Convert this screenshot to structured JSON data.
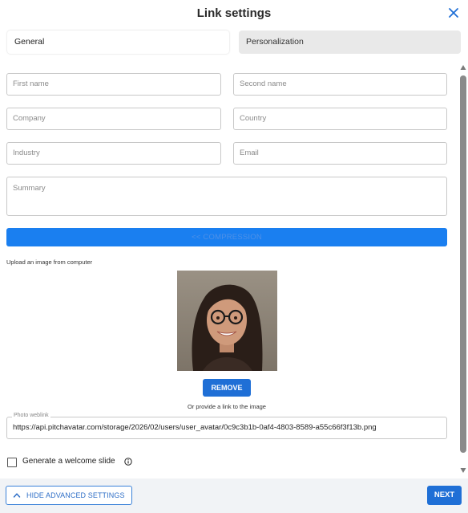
{
  "dialog": {
    "title": "Link settings"
  },
  "tabs": [
    {
      "label": "General"
    },
    {
      "label": "Personalization"
    }
  ],
  "fields": {
    "first_name": {
      "placeholder": "First name",
      "value": ""
    },
    "second_name": {
      "placeholder": "Second name",
      "value": ""
    },
    "company": {
      "placeholder": "Company",
      "value": ""
    },
    "country": {
      "placeholder": "Country",
      "value": ""
    },
    "industry": {
      "placeholder": "Industry",
      "value": ""
    },
    "email": {
      "placeholder": "Email",
      "value": ""
    },
    "summary": {
      "placeholder": "Summary",
      "value": ""
    }
  },
  "compression": {
    "label": "<< COMPRESSION"
  },
  "upload": {
    "label": "Upload an image from computer",
    "remove_label": "REMOVE",
    "link_note": "Or provide a link to the image"
  },
  "photo_weblink": {
    "label": "Photo weblink",
    "value": "https://api.pitchavatar.com/storage/2026/02/users/user_avatar/0c9c3b1b-0af4-4803-8589-a55c66f3f13b.png"
  },
  "welcome": {
    "label": "Generate a welcome slide",
    "checked": false
  },
  "footer": {
    "hide_label": "HIDE ADVANCED SETTINGS",
    "next_label": "NEXT"
  },
  "colors": {
    "primary": "#1f6fd6",
    "compress_bar": "#1a7ff0",
    "footer_bg": "#f1f3f6",
    "tab_inactive": "#e9e9e9"
  }
}
